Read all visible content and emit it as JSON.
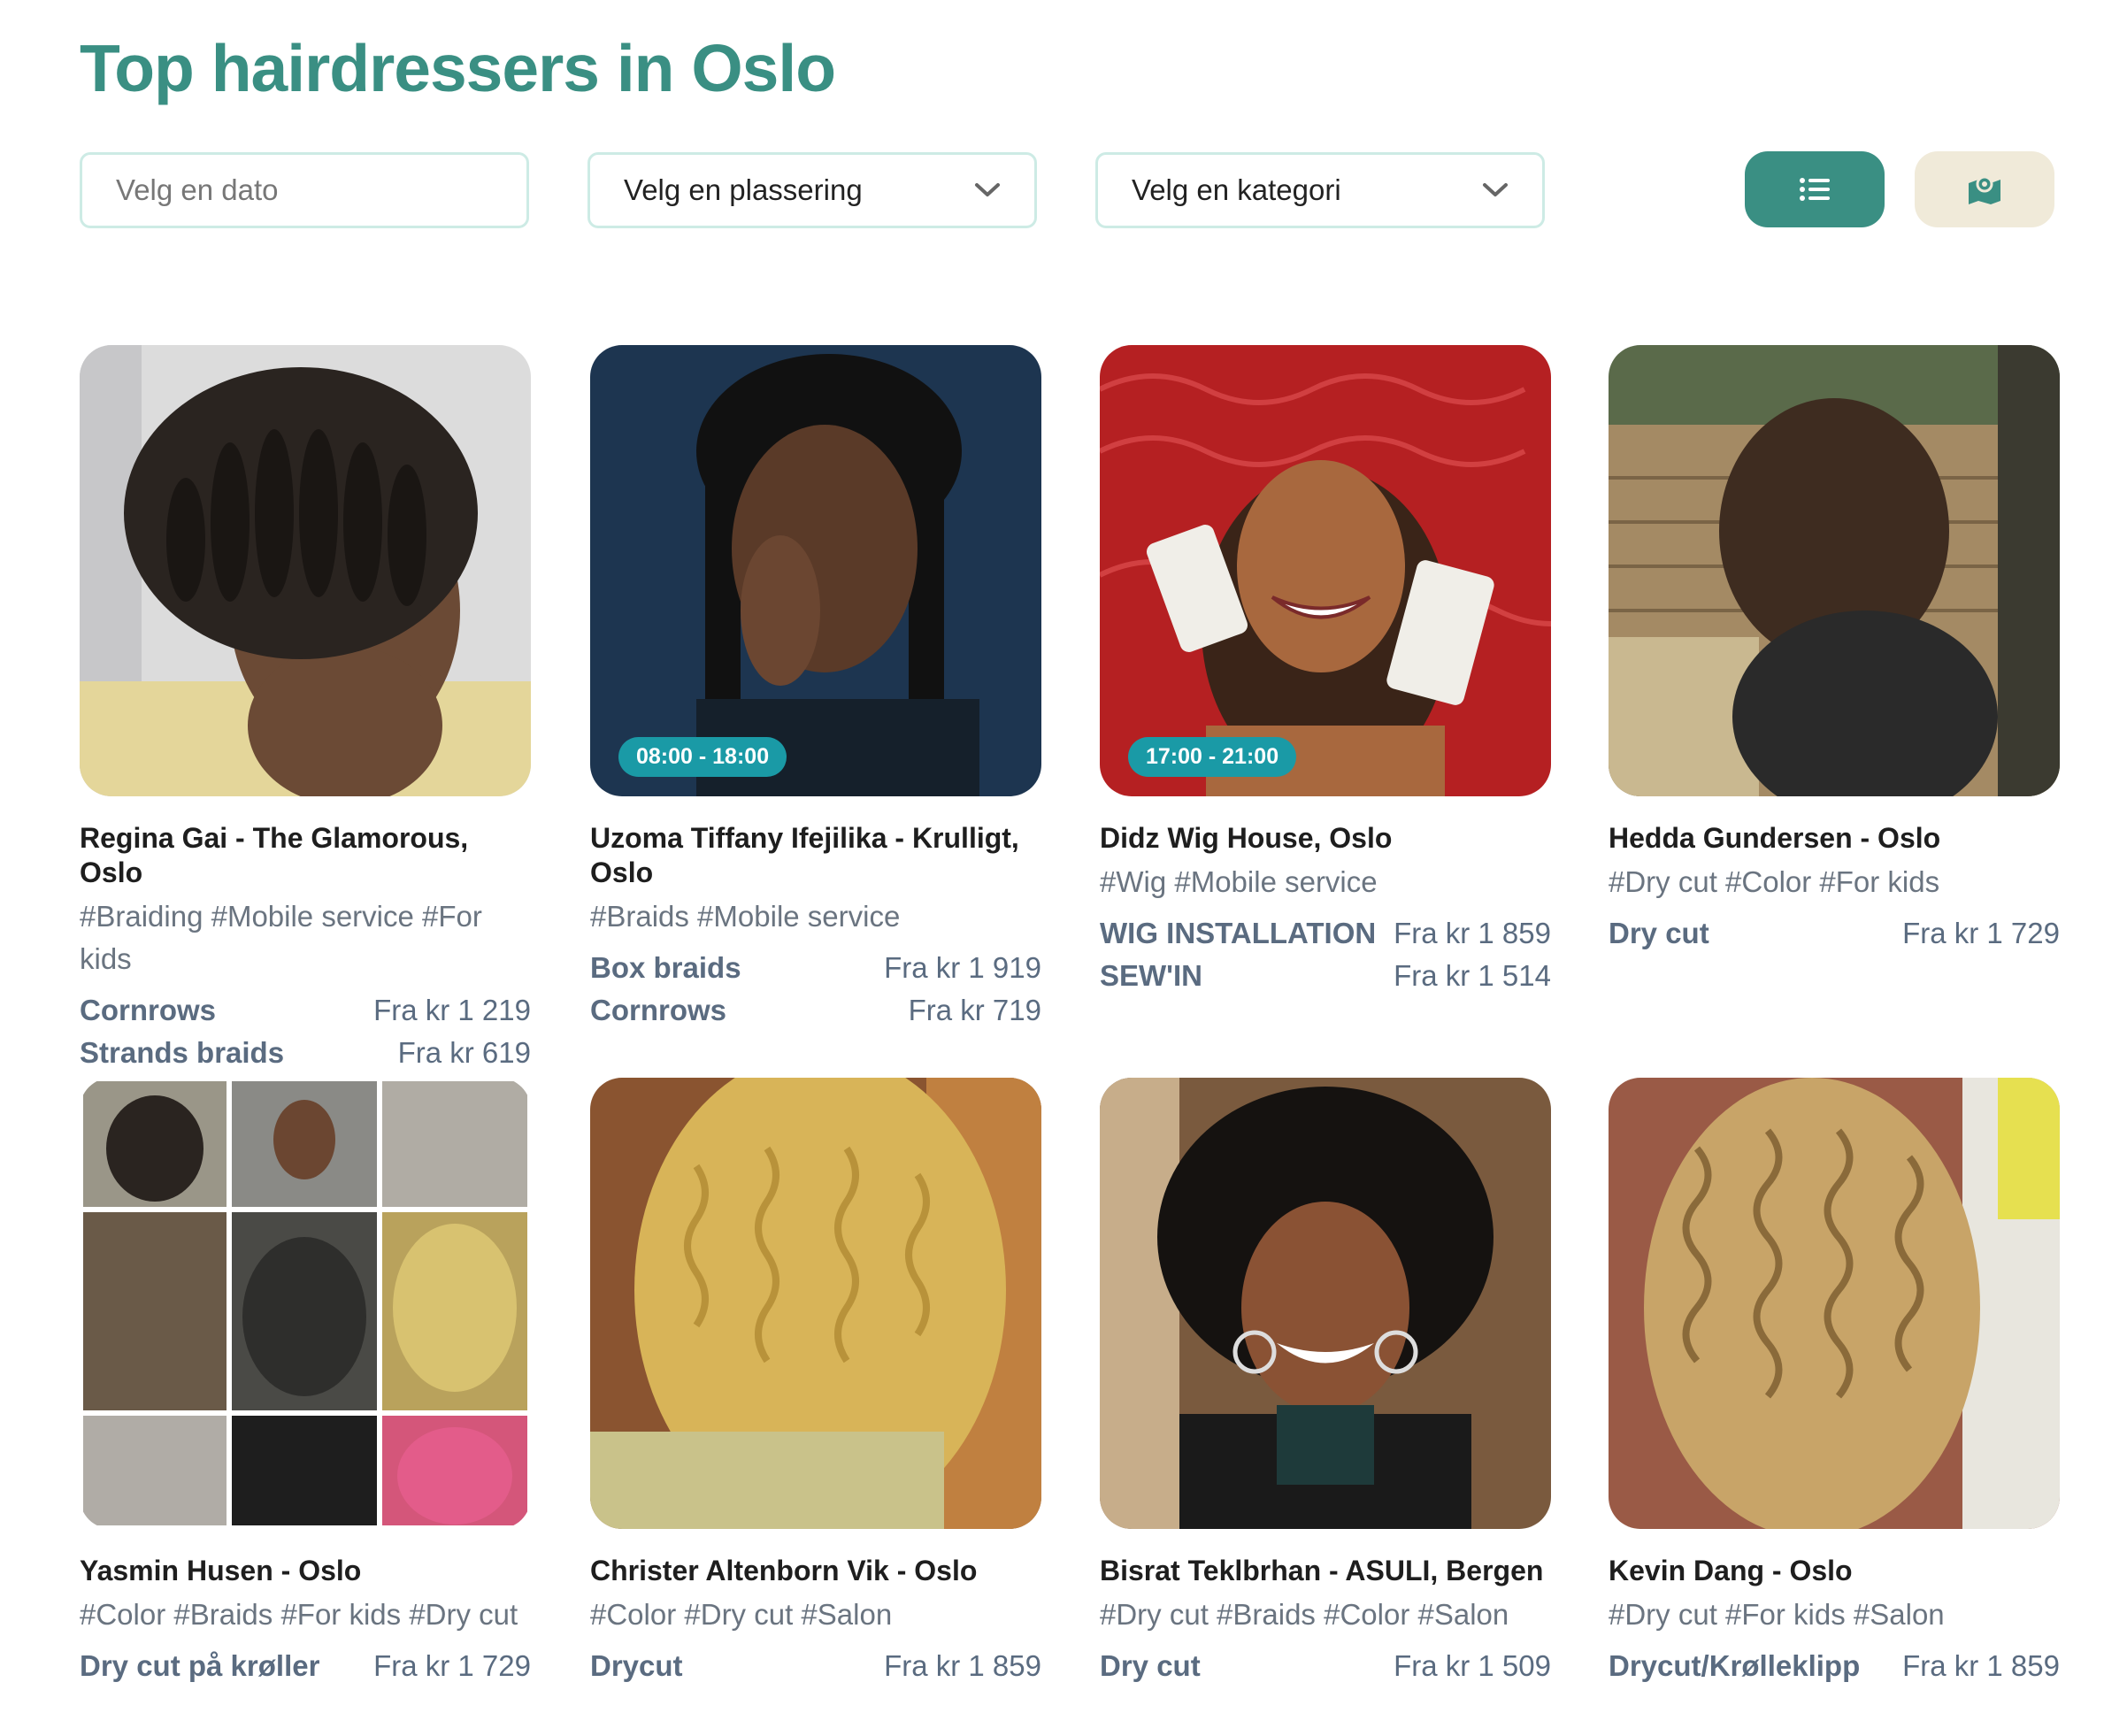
{
  "header": {
    "title": "Top hairdressers in Oslo"
  },
  "filters": {
    "date_placeholder": "Velg en dato",
    "location_label": "Velg en plassering",
    "category_label": "Velg en kategori"
  },
  "view_toggle": {
    "list_icon": "list-icon",
    "map_icon": "map-icon",
    "accent": "#3a8f83",
    "map_bg": "#f0ead9"
  },
  "cards": [
    {
      "name": "Regina Gai - The Glamorous, Oslo",
      "tags": "#Braiding #Mobile service #For kids",
      "hours": "",
      "services": [
        {
          "name": "Cornrows",
          "price": "Fra kr 1 219"
        },
        {
          "name": "Strands braids",
          "price": "Fra kr 619"
        }
      ]
    },
    {
      "name": "Uzoma Tiffany Ifejilika - Krulligt, Oslo",
      "tags": "#Braids #Mobile service",
      "hours": "08:00 - 18:00",
      "services": [
        {
          "name": "Box braids",
          "price": "Fra kr 1 919"
        },
        {
          "name": "Cornrows",
          "price": "Fra kr 719"
        }
      ]
    },
    {
      "name": "Didz Wig House, Oslo",
      "tags": "#Wig #Mobile service",
      "hours": "17:00 - 21:00",
      "services": [
        {
          "name": "WIG INSTALLATION",
          "price": "Fra kr 1 859"
        },
        {
          "name": "SEW'IN",
          "price": "Fra kr 1 514"
        }
      ]
    },
    {
      "name": "Hedda Gundersen - Oslo",
      "tags": "#Dry cut #Color #For kids",
      "hours": "",
      "services": [
        {
          "name": "Dry cut",
          "price": "Fra kr 1 729"
        }
      ]
    },
    {
      "name": "Yasmin Husen - Oslo",
      "tags": "#Color #Braids #For kids #Dry cut",
      "hours": "",
      "services": [
        {
          "name": "Dry cut på krøller",
          "price": "Fra kr 1 729"
        }
      ]
    },
    {
      "name": "Christer Altenborn Vik - Oslo",
      "tags": "#Color #Dry cut #Salon",
      "hours": "",
      "services": [
        {
          "name": "Drycut",
          "price": "Fra kr 1 859"
        }
      ]
    },
    {
      "name": "Bisrat Teklbrhan - ASULI, Bergen",
      "tags": "#Dry cut #Braids #Color #Salon",
      "hours": "",
      "services": [
        {
          "name": "Dry cut",
          "price": "Fra kr 1 509"
        }
      ]
    },
    {
      "name": "Kevin Dang - Oslo",
      "tags": "#Dry cut #For kids #Salon",
      "hours": "",
      "services": [
        {
          "name": "Drycut/Krølleklipp",
          "price": "Fra kr 1 859"
        }
      ]
    }
  ]
}
